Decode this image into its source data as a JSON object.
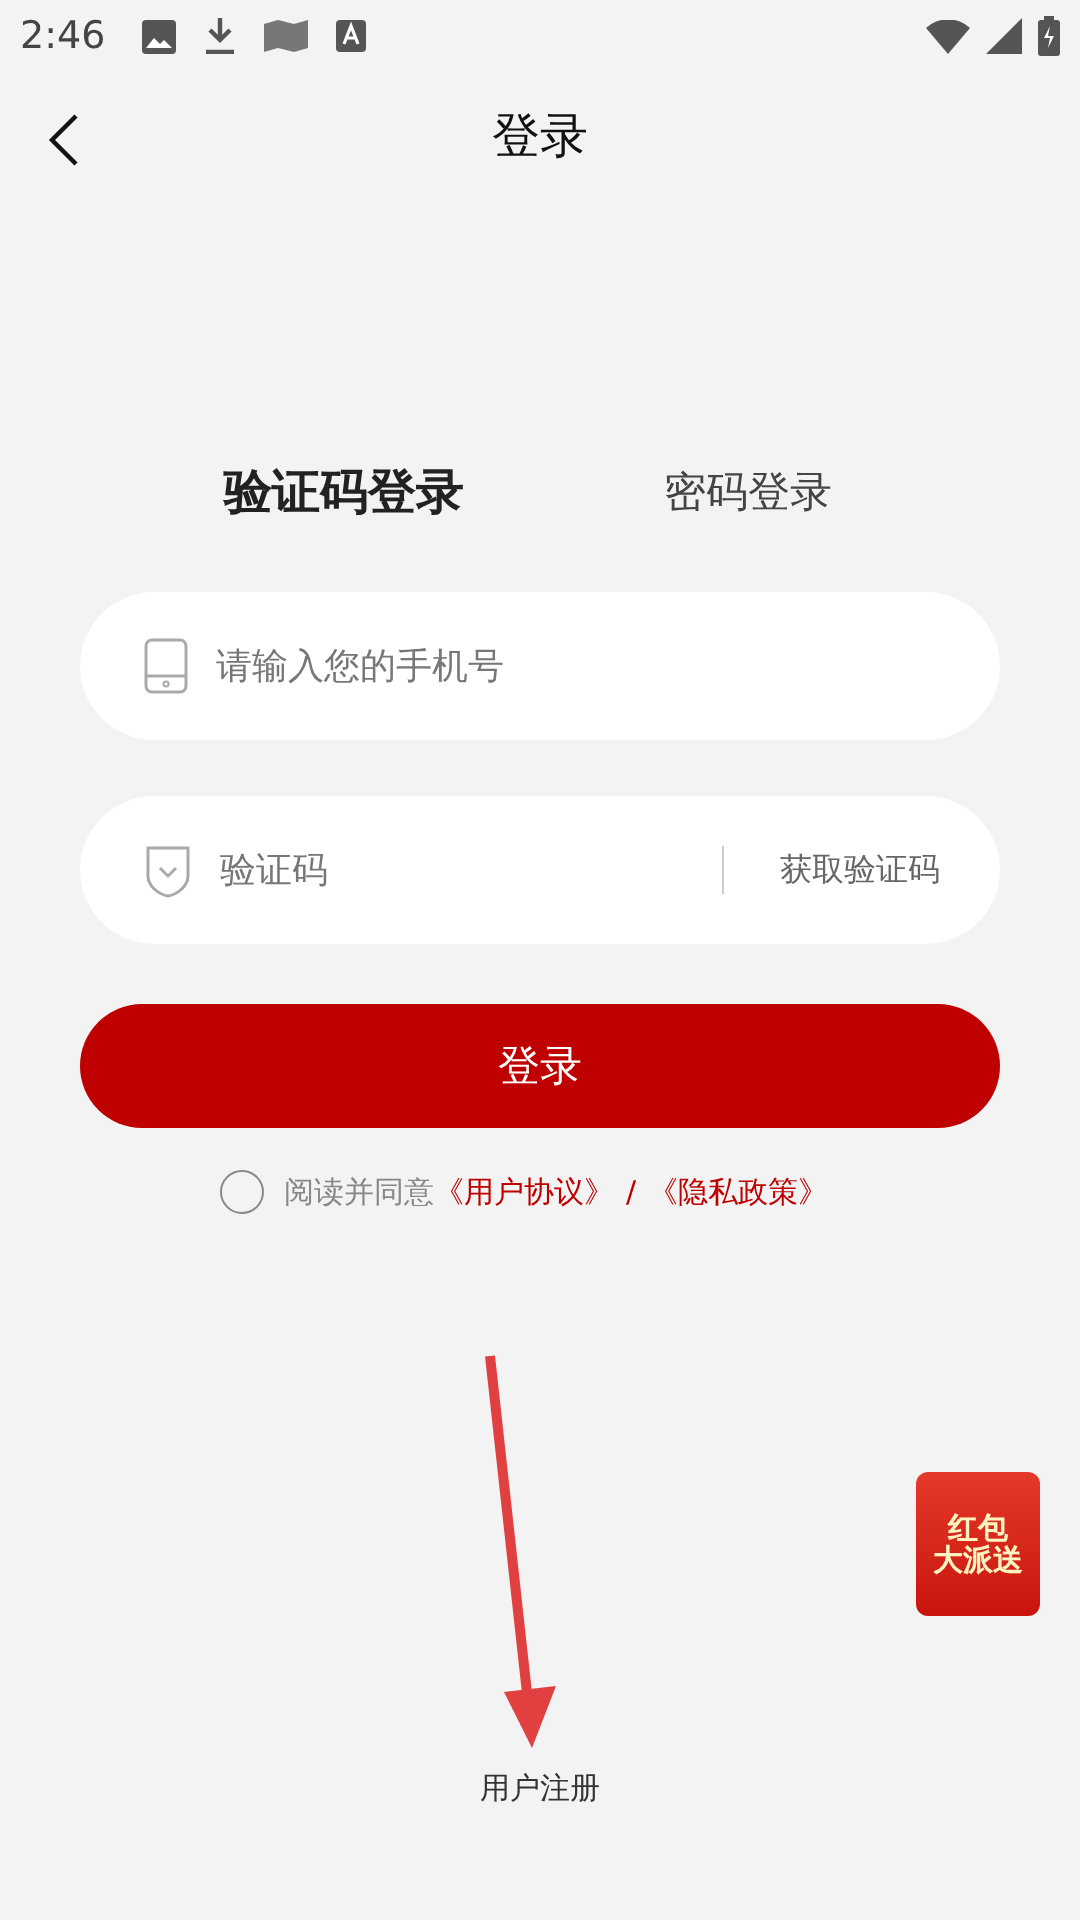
{
  "status_bar": {
    "time": "2:46"
  },
  "header": {
    "title": "登录"
  },
  "tabs": [
    {
      "label": "验证码登录",
      "selected": true
    },
    {
      "label": "密码登录",
      "selected": false
    }
  ],
  "phone_field": {
    "placeholder": "请输入您的手机号"
  },
  "code_field": {
    "placeholder": "验证码",
    "action": "获取验证码"
  },
  "login_button": "登录",
  "agreement": {
    "checked": false,
    "text": "阅读并同意",
    "links": [
      "《用户协议》",
      "《隐私政策》"
    ],
    "separator": "/"
  },
  "promo_badge": {
    "line_1": "红包",
    "line_2": "大派送"
  },
  "register_link": "用户注册"
}
